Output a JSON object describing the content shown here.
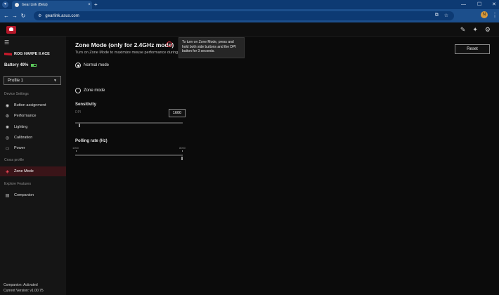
{
  "browser": {
    "tab_title": "Gear Link (Beta)",
    "tab_close": "×",
    "new_tab": "+",
    "url": "gearlink.asus.com",
    "profile_initial": "N",
    "window_controls": [
      "—",
      "☐",
      "✕"
    ]
  },
  "app_header": {
    "icons": [
      "edit-icon",
      "support-icon",
      "settings-icon"
    ]
  },
  "sidebar": {
    "device_name": "ROG HARPE II ACE",
    "battery": "Battery 49%",
    "profile": "Profile 1",
    "sections": {
      "device_settings": "Device Settings",
      "cross_profile": "Cross profile",
      "explore_features": "Explore Features"
    },
    "items": [
      {
        "label": "Button assignment",
        "icon": "mouse-icon"
      },
      {
        "label": "Performance",
        "icon": "performance-icon"
      },
      {
        "label": "Lighting",
        "icon": "lighting-icon"
      },
      {
        "label": "Calibration",
        "icon": "calibration-icon"
      },
      {
        "label": "Power",
        "icon": "power-icon"
      },
      {
        "label": "Zone Mode",
        "icon": "zone-mode-icon"
      },
      {
        "label": "Companion",
        "icon": "companion-icon"
      }
    ],
    "footer": {
      "companion_status": "Companion: Activated",
      "version": "Current Version: v1.00.75"
    }
  },
  "main": {
    "title": "Zone Mode (only for 2.4GHz mode)",
    "description": "Turn on Zone Mode to maximize mouse performance during g",
    "tooltip": [
      "To turn on Zone Mode, press and",
      "hold both side buttons and the DPI",
      "button for 3 seconds."
    ],
    "reset_label": "Reset",
    "mode_options": [
      {
        "label": "Normal mode",
        "checked": true
      },
      {
        "label": "Zone mode",
        "checked": false
      }
    ],
    "sensitivity": {
      "label": "Sensitivity",
      "dpi_label": "DPI",
      "dpi_value": "1600"
    },
    "polling": {
      "label": "Polling rate (Hz)",
      "min": "1000",
      "max": "8000"
    }
  }
}
